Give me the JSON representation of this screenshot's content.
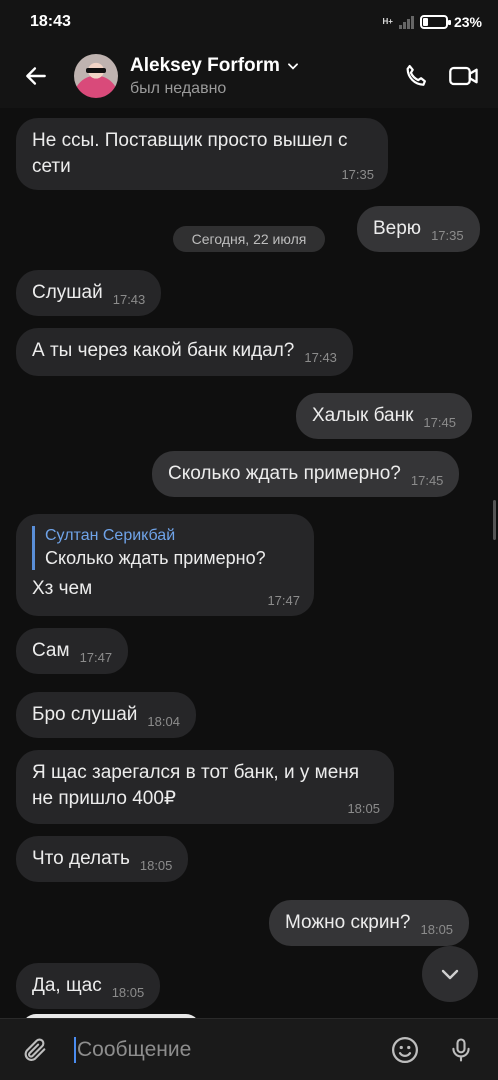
{
  "statusbar": {
    "time": "18:43",
    "network": "H+",
    "battery": "23%"
  },
  "header": {
    "name": "Aleksey Forform",
    "status": "был недавно"
  },
  "chat": {
    "date": "Сегодня, 22 июля",
    "messages": [
      {
        "text": "Не ссы. Поставщик просто вышел с сети",
        "time": "17:35"
      },
      {
        "text": "Верю",
        "time": "17:35"
      },
      {
        "text": "Слушай",
        "time": "17:43"
      },
      {
        "text": "А ты через какой банк кидал?",
        "time": "17:43"
      },
      {
        "text": "Халык банк",
        "time": "17:45"
      },
      {
        "text": "Сколько ждать примерно?",
        "time": "17:45"
      },
      {
        "reply_author": "Султан Серикбай",
        "reply_text": "Сколько ждать примерно?",
        "text": "Хз чем",
        "time": "17:47"
      },
      {
        "text": "Сам",
        "time": "17:47"
      },
      {
        "text": "Бро слушай",
        "time": "18:04"
      },
      {
        "text": "Я щас зарегался в тот банк, и у меня не пришло 400₽",
        "time": "18:05"
      },
      {
        "text": "Что делать",
        "time": "18:05"
      },
      {
        "text": "Можно скрин?",
        "time": "18:05"
      },
      {
        "text": "Да, щас",
        "time": "18:05"
      }
    ]
  },
  "input": {
    "placeholder": "Сообщение"
  },
  "icons": {
    "back": "arrow-left-icon",
    "call": "phone-icon",
    "video": "video-icon",
    "attach": "paperclip-icon",
    "emoji": "emoji-icon",
    "mic": "microphone-icon",
    "scroll_down": "chevron-down-icon"
  }
}
